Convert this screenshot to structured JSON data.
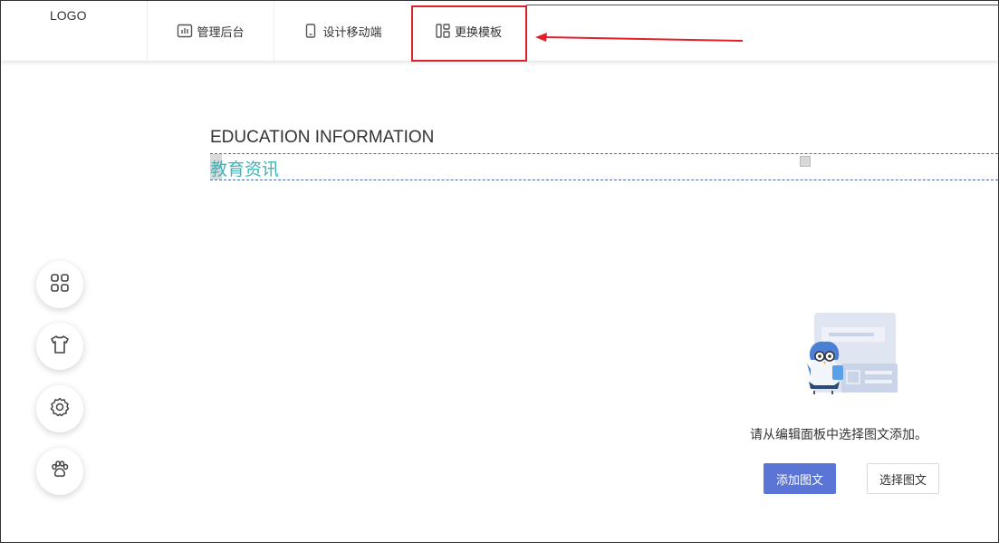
{
  "header": {
    "logo": "LOGO",
    "nav": [
      {
        "label": "管理后台",
        "icon": "bar-chart-icon"
      },
      {
        "label": "设计移动端",
        "icon": "mobile-icon"
      },
      {
        "label": "更换模板",
        "icon": "template-icon"
      }
    ]
  },
  "content": {
    "title": "EDUCATION INFORMATION",
    "subtitle": "教育资讯",
    "empty_message": "请从编辑面板中选择图文添加。",
    "add_button": "添加图文",
    "select_button": "选择图文"
  },
  "sidebar": {
    "buttons": [
      {
        "icon": "grid-icon"
      },
      {
        "icon": "shirt-icon"
      },
      {
        "icon": "gear-icon"
      },
      {
        "icon": "paw-icon"
      }
    ]
  },
  "colors": {
    "accent": "#5a75d6",
    "subtitle": "#3bb6b8",
    "highlight": "#e0202a"
  }
}
